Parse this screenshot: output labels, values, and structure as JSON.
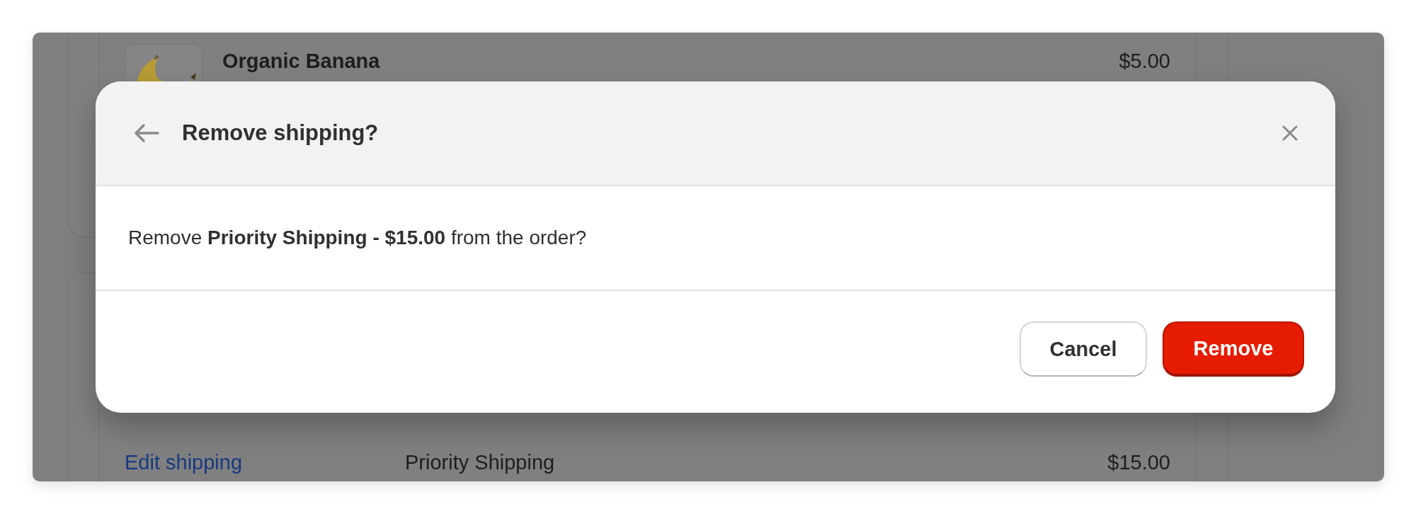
{
  "background": {
    "line_item": {
      "name": "Organic Banana",
      "price": "$5.00"
    },
    "shipping": {
      "link": "Edit shipping",
      "method": "Priority Shipping",
      "price": "$15.00"
    }
  },
  "dialog": {
    "title": "Remove shipping?",
    "message": "Remove **Priority Shipping - $15.00** from the order?",
    "buttons": [
      {
        "label": "Cancel",
        "kind": "secondary"
      },
      {
        "label": "Remove",
        "kind": "destructive"
      }
    ]
  }
}
